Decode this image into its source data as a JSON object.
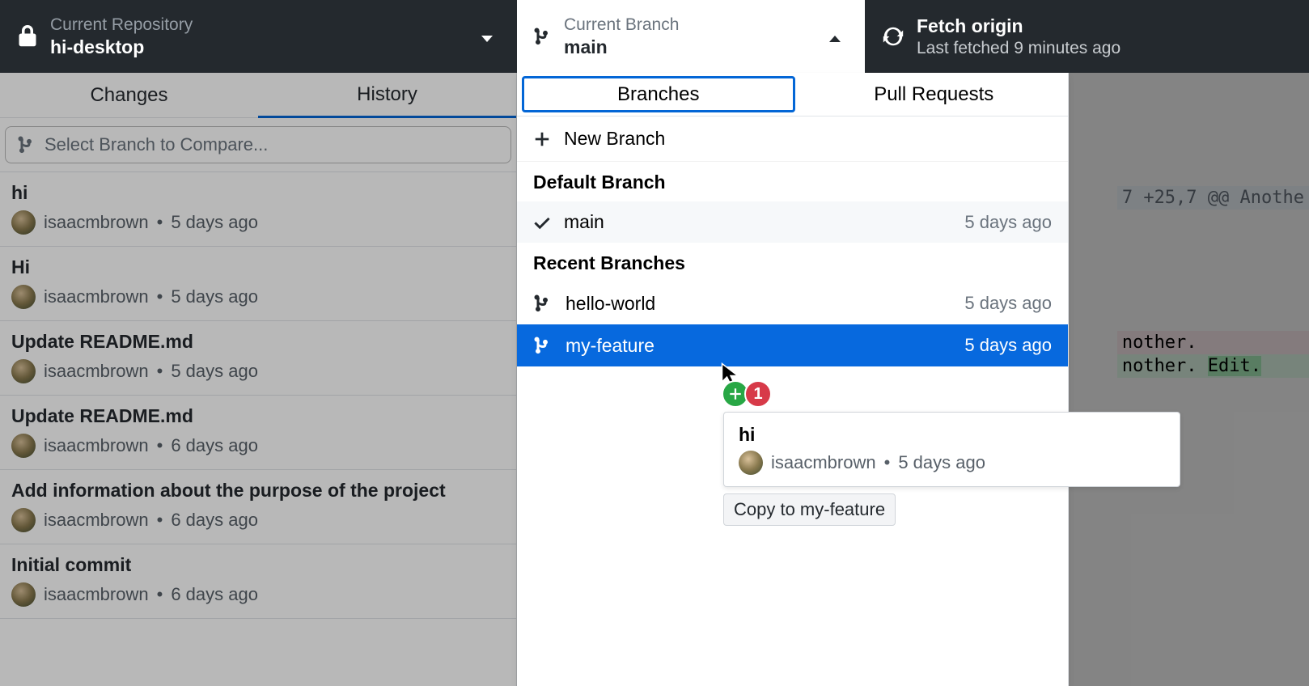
{
  "topbar": {
    "repo_label": "Current Repository",
    "repo_value": "hi-desktop",
    "branch_label": "Current Branch",
    "branch_value": "main",
    "fetch_label": "Fetch origin",
    "fetch_sub": "Last fetched 9 minutes ago"
  },
  "left_tabs": {
    "changes": "Changes",
    "history": "History"
  },
  "compare_placeholder": "Select Branch to Compare...",
  "commits": [
    {
      "title": "hi",
      "author": "isaacmbrown",
      "time": "5 days ago"
    },
    {
      "title": "Hi",
      "author": "isaacmbrown",
      "time": "5 days ago"
    },
    {
      "title": "Update README.md",
      "author": "isaacmbrown",
      "time": "5 days ago"
    },
    {
      "title": "Update README.md",
      "author": "isaacmbrown",
      "time": "6 days ago"
    },
    {
      "title": "Add information about the purpose of the project",
      "author": "isaacmbrown",
      "time": "6 days ago"
    },
    {
      "title": "Initial commit",
      "author": "isaacmbrown",
      "time": "6 days ago"
    }
  ],
  "branch_dropdown": {
    "tabs": {
      "branches": "Branches",
      "prs": "Pull Requests"
    },
    "new_branch": "New Branch",
    "default_heading": "Default Branch",
    "recent_heading": "Recent Branches",
    "default_branch": {
      "name": "main",
      "time": "5 days ago"
    },
    "recent": [
      {
        "name": "hello-world",
        "time": "5 days ago"
      },
      {
        "name": "my-feature",
        "time": "5 days ago"
      }
    ]
  },
  "drag": {
    "count": "1",
    "commit_title": "hi",
    "commit_author": "isaacmbrown",
    "commit_time": "5 days ago",
    "hint": "Copy to my-feature"
  },
  "diff": {
    "hunk": "7 +25,7 @@ Anothe",
    "line_minus": "nother.",
    "line_plus_a": "nother.",
    "line_plus_b": "Edit."
  }
}
